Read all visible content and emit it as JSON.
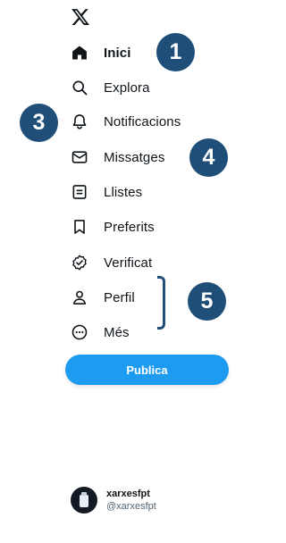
{
  "nav": {
    "items": [
      {
        "label": "Inici",
        "icon": "home-icon",
        "active": true
      },
      {
        "label": "Explora",
        "icon": "search-icon",
        "active": false
      },
      {
        "label": "Notificacions",
        "icon": "bell-icon",
        "active": false
      },
      {
        "label": "Missatges",
        "icon": "envelope-icon",
        "active": false
      },
      {
        "label": "Llistes",
        "icon": "list-icon",
        "active": false
      },
      {
        "label": "Preferits",
        "icon": "bookmark-icon",
        "active": false
      },
      {
        "label": "Verificat",
        "icon": "verified-icon",
        "active": false
      },
      {
        "label": "Perfil",
        "icon": "person-icon",
        "active": false
      },
      {
        "label": "Més",
        "icon": "more-circle-icon",
        "active": false
      }
    ]
  },
  "publish_label": "Publica",
  "account": {
    "name": "xarxesfpt",
    "handle": "@xarxesfpt"
  },
  "annotations": {
    "badge_1": "1",
    "badge_3": "3",
    "badge_4": "4",
    "badge_5": "5"
  },
  "colors": {
    "accent": "#1d9bf0",
    "annotation": "#1f4e79",
    "text": "#0f1419",
    "secondary_text": "#536471"
  }
}
